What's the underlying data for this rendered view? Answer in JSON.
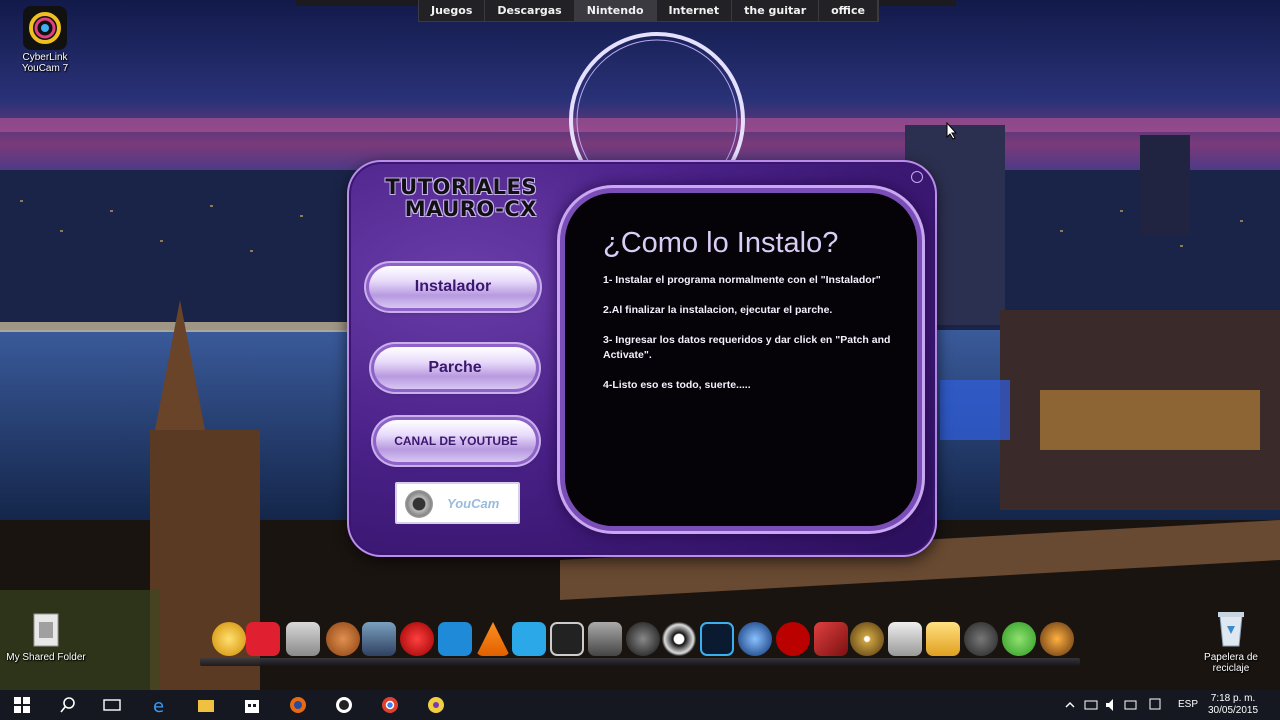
{
  "top_menu": {
    "items": [
      "Juegos",
      "Descargas",
      "Nintendo",
      "Internet",
      "the guitar",
      "office"
    ],
    "active": "Nintendo"
  },
  "desktop": {
    "icon_top_left": "CyberLink YouCam 7",
    "icon_bottom_left": "My Shared Folder",
    "icon_bottom_right": "Papelera de reciclaje"
  },
  "installer": {
    "title_line1": "TUTORIALES",
    "title_line2": "MAURO-CX",
    "buttons": {
      "instalador": "Instalador",
      "parche": "Parche",
      "canal": "CANAL DE YOUTUBE"
    },
    "logo_text": "YouCam",
    "panel": {
      "heading": "¿Como lo Instalo?",
      "steps": [
        "1- Instalar el programa normalmente con el \"Instalador\"",
        "2.Al finalizar la instalacion, ejecutar el parche.",
        "3- Ingresar los datos requeridos y dar click en \"Patch and Activate\".",
        "4-Listo eso es todo, suerte....."
      ]
    }
  },
  "taskbar": {
    "language": "ESP",
    "time": "7:18 p. m.",
    "date": "30/05/2015"
  },
  "colors": {
    "window_purple": "#4a2188",
    "panel_black": "#050307",
    "button_text": "#3b176f"
  }
}
